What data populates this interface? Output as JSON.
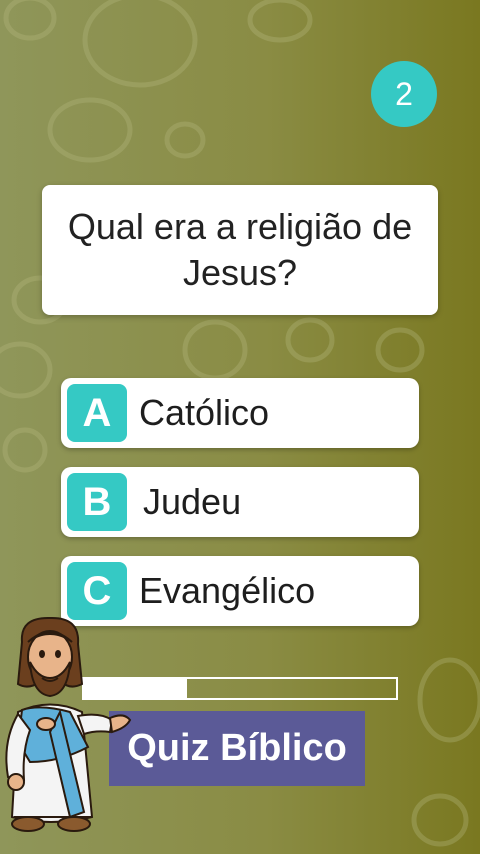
{
  "counter": "2",
  "question": "Qual era a religião de Jesus?",
  "options": [
    {
      "letter": "A",
      "label": "Católico"
    },
    {
      "letter": "B",
      "label": "Judeu"
    },
    {
      "letter": "C",
      "label": "Evangélico"
    }
  ],
  "progress": 0.33,
  "title": "Quiz Bíblico",
  "colors": {
    "accent": "#35c9c4",
    "title_bg": "#5b5a97",
    "background": "#8a8c44"
  },
  "icons": {
    "character": "jesus-cartoon-illustration"
  }
}
